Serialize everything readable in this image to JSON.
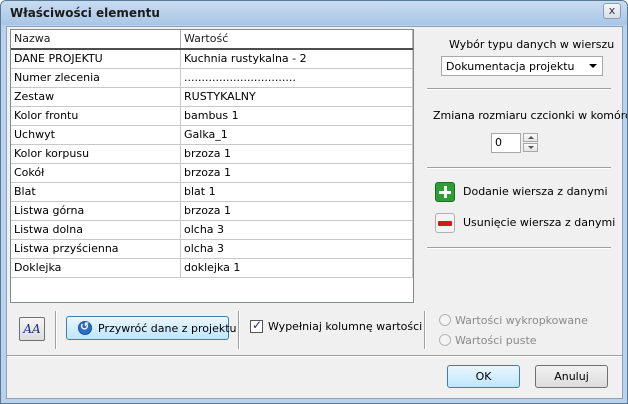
{
  "window": {
    "title": "Właściwości elementu",
    "close_glyph": "x"
  },
  "grid": {
    "headers": [
      "Nazwa",
      "Wartość"
    ],
    "rows": [
      [
        "DANE PROJEKTU",
        "Kuchnia rustykalna - 2"
      ],
      [
        "Numer zlecenia",
        "................................"
      ],
      [
        "Zestaw",
        "RUSTYKALNY"
      ],
      [
        "Kolor frontu",
        "bambus 1"
      ],
      [
        "Uchwyt",
        "Galka_1"
      ],
      [
        "Kolor korpusu",
        "brzoza 1"
      ],
      [
        "Cokół",
        "brzoza 1"
      ],
      [
        "Blat",
        "blat 1"
      ],
      [
        "Listwa górna",
        "brzoza 1"
      ],
      [
        "Listwa dolna",
        "olcha 3"
      ],
      [
        "Listwa przyścienna",
        "olcha 3"
      ],
      [
        "Doklejka",
        "doklejka 1"
      ]
    ]
  },
  "right_panel": {
    "data_type_label": "Wybór typu danych w wierszu",
    "data_type_value": "Dokumentacja projektu",
    "font_size_label": "Zmiana rozmiaru czcionki w komórce",
    "font_size_value": "0",
    "add_row_label": "Dodanie wiersza z danymi",
    "remove_row_label": "Usunięcie wiersza z danymi"
  },
  "bottom": {
    "font_button_text": "AA",
    "restore_label": "Przywróć dane z projektu",
    "fill_values_label": "Wypełniaj kolumnę wartości",
    "fill_values_checked": true,
    "radio_dotted_label": "Wartości wykropkowane",
    "radio_empty_label": "Wartości puste"
  },
  "buttons": {
    "ok": "OK",
    "cancel": "Anuluj"
  }
}
